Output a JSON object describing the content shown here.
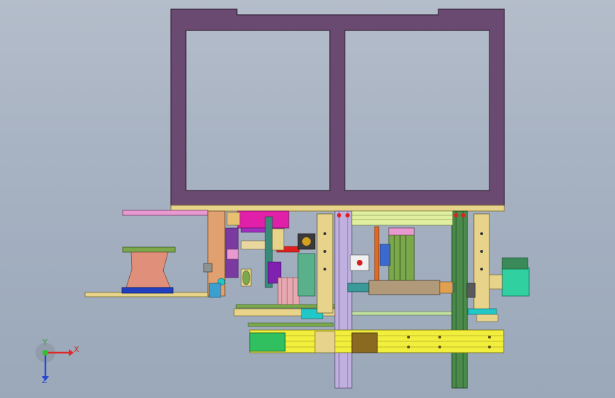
{
  "viewport": {
    "background_top": "#b4bdca",
    "background_bottom": "#9aa8b9"
  },
  "model": {
    "frame_color": "#6a4a70",
    "colors": {
      "beige": "#e7d48a",
      "magenta": "#e020a8",
      "pink": "#e89ad0",
      "salmon": "#e0907a",
      "green_shelf": "#7aa84a",
      "blue": "#2040c0",
      "yellow": "#f2ee3c",
      "cyan": "#20c8c8",
      "green_rail": "#4a8a4a",
      "violet": "#c0b0e0",
      "red": "#e02020",
      "orange": "#e06a20"
    }
  },
  "triad": {
    "x_label": "X",
    "y_label": "Y",
    "z_label": "Z",
    "x_color": "#e02828",
    "y_color": "#30c030",
    "z_color": "#2848d0"
  }
}
